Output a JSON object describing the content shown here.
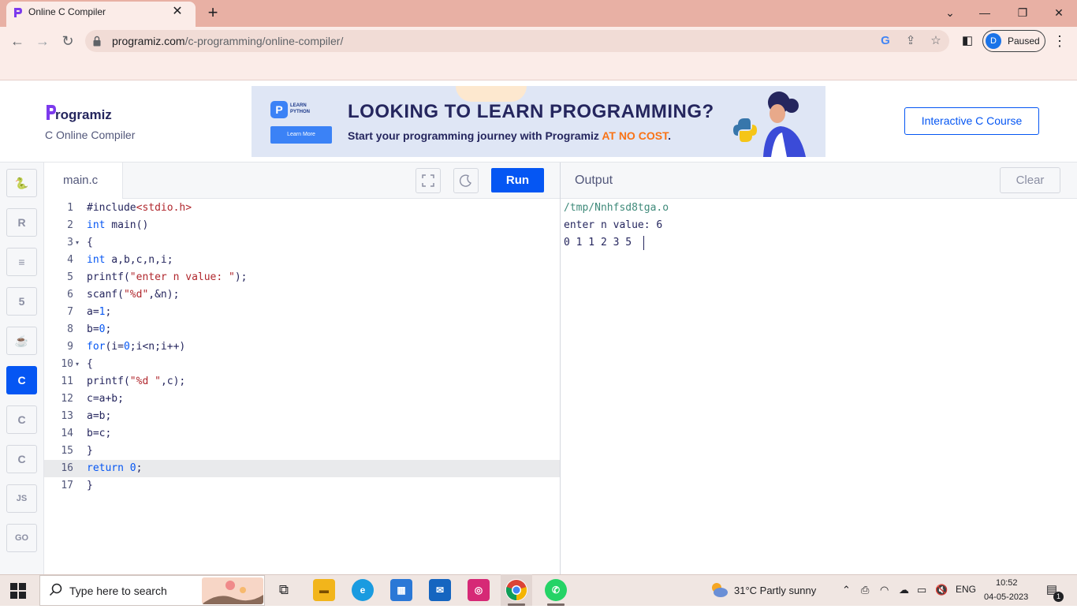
{
  "browser": {
    "tab_title": "Online C Compiler",
    "tab_close": "✕",
    "new_tab": "+",
    "url_host": "programiz.com",
    "url_path": "/c-programming/online-compiler/",
    "profile_initial": "D",
    "profile_label": "Paused"
  },
  "site": {
    "logo_text": "rogramiz",
    "subtitle": "C Online Compiler",
    "course_button": "Interactive C Course"
  },
  "ad": {
    "card_text": "LEARN PYTHON",
    "card_button": "Learn More",
    "headline": "LOOKING TO LEARN PROGRAMMING?",
    "sub_text": "Start your programming journey with Programiz ",
    "sub_highlight": "AT NO COST",
    "sub_end": "."
  },
  "sidebar": {
    "languages": [
      {
        "name": "python",
        "glyph": "🐍",
        "active": false
      },
      {
        "name": "r",
        "glyph": "R",
        "active": false
      },
      {
        "name": "sql",
        "glyph": "≡",
        "active": false
      },
      {
        "name": "html",
        "glyph": "5",
        "active": false
      },
      {
        "name": "java",
        "glyph": "☕",
        "active": false
      },
      {
        "name": "c",
        "glyph": "C",
        "active": true
      },
      {
        "name": "cpp",
        "glyph": "C",
        "active": false
      },
      {
        "name": "csharp",
        "glyph": "C",
        "active": false
      },
      {
        "name": "javascript",
        "glyph": "JS",
        "active": false
      },
      {
        "name": "go",
        "glyph": "GO",
        "active": false
      }
    ]
  },
  "editor": {
    "filename": "main.c",
    "run_label": "Run",
    "lines": [
      {
        "n": "1",
        "text": "#include<stdio.h>"
      },
      {
        "n": "2",
        "text": "int main()"
      },
      {
        "n": "3",
        "text": "{",
        "fold": "▾"
      },
      {
        "n": "4",
        "text": "int a,b,c,n,i;"
      },
      {
        "n": "5",
        "text": "printf(\"enter n value: \");"
      },
      {
        "n": "6",
        "text": "scanf(\"%d\",&n);"
      },
      {
        "n": "7",
        "text": "a=1;"
      },
      {
        "n": "8",
        "text": "b=0;"
      },
      {
        "n": "9",
        "text": "for(i=0;i<n;i++)"
      },
      {
        "n": "10",
        "text": "{",
        "fold": "▾"
      },
      {
        "n": "11",
        "text": "printf(\"%d \",c);"
      },
      {
        "n": "12",
        "text": "c=a+b;"
      },
      {
        "n": "13",
        "text": "a=b;"
      },
      {
        "n": "14",
        "text": "b=c;"
      },
      {
        "n": "15",
        "text": "}"
      },
      {
        "n": "16",
        "text": "return 0;"
      },
      {
        "n": "17",
        "text": "}"
      }
    ]
  },
  "output": {
    "title": "Output",
    "clear_label": "Clear",
    "lines": [
      "/tmp/Nnhfsd8tga.o",
      "enter n value: 6",
      "0 1 1 2 3 5 "
    ]
  },
  "taskbar": {
    "search_placeholder": "Type here to search",
    "weather": "31°C  Partly sunny",
    "language": "ENG",
    "time": "10:52",
    "date": "04-05-2023",
    "notification_count": "1"
  }
}
